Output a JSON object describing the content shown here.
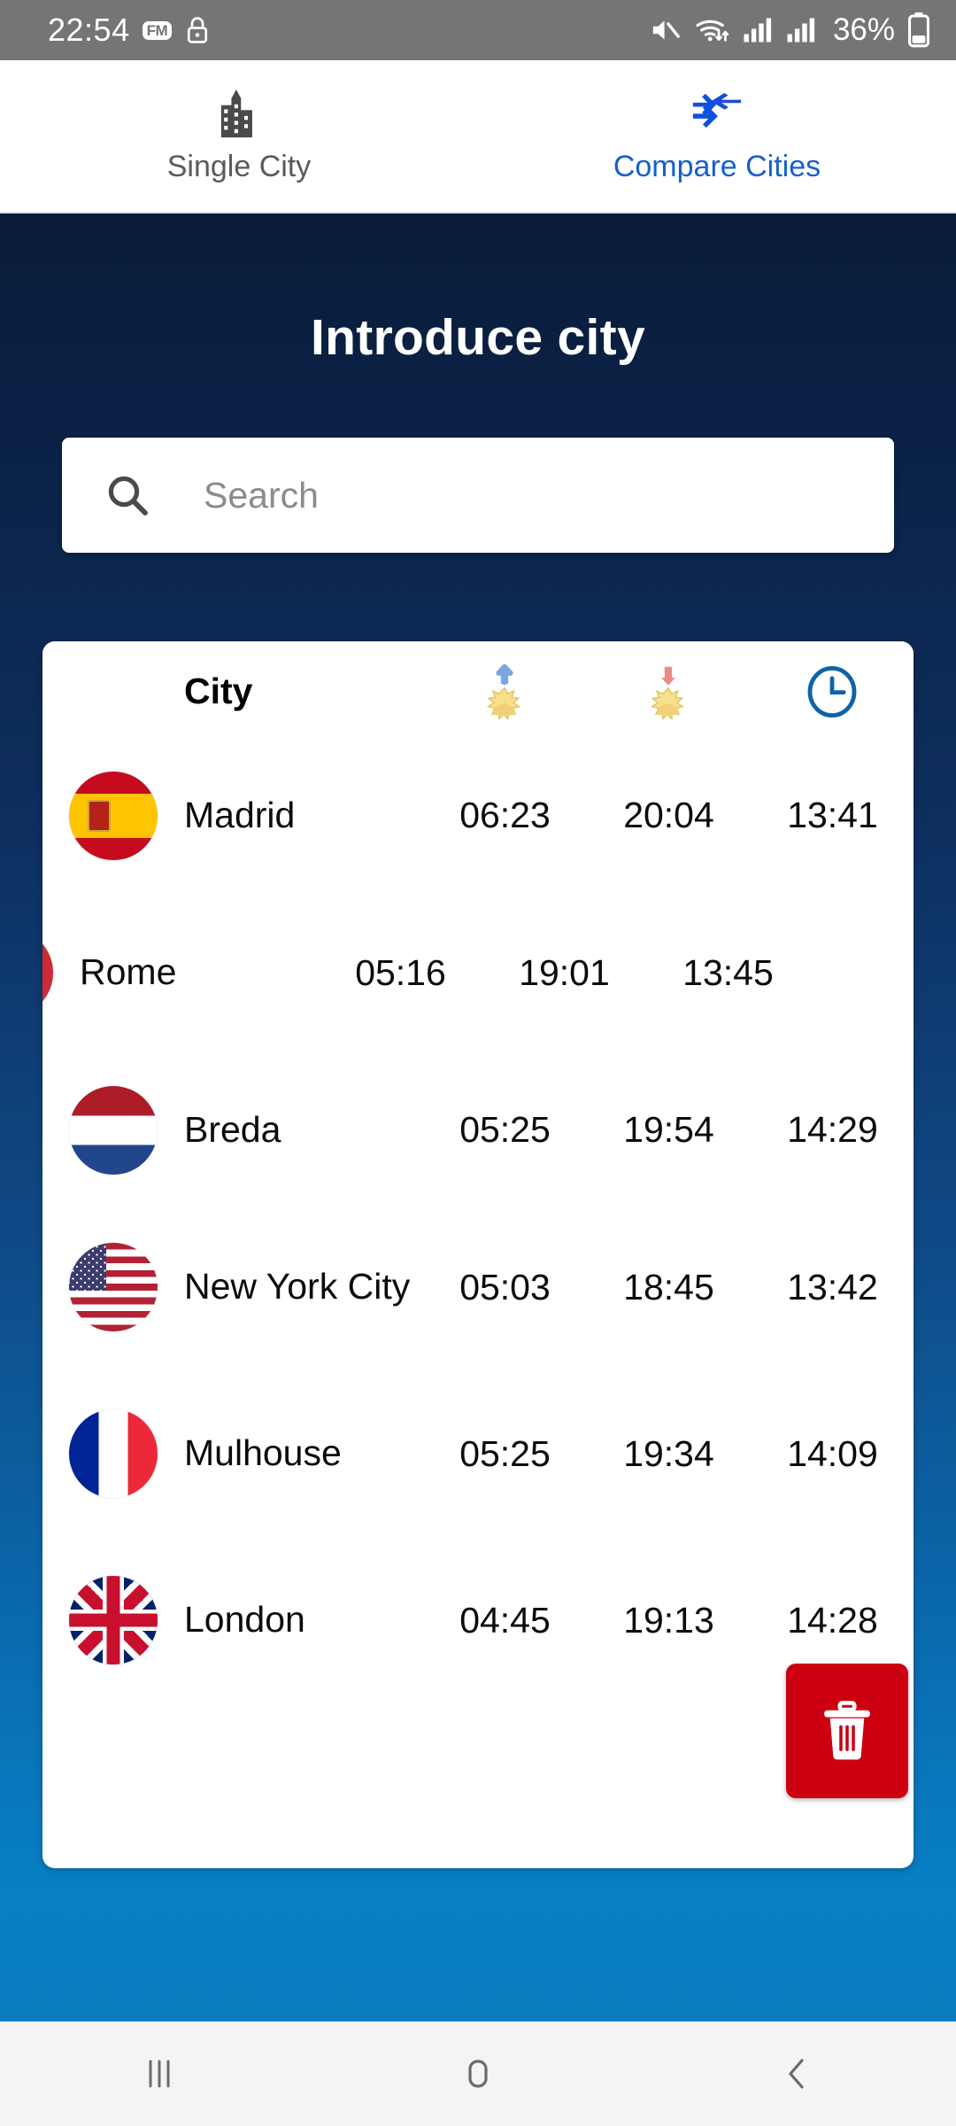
{
  "status_bar": {
    "time": "22:54",
    "fm_badge": "FM",
    "icons_left": [
      "fm-icon",
      "lock-icon"
    ],
    "icons_right": [
      "mute-icon",
      "wifi-icon",
      "signal-icon",
      "signal-icon-2"
    ],
    "battery_text": "36%",
    "battery_icon": "battery-icon"
  },
  "tabs": [
    {
      "label": "Single City",
      "icon": "city-buildings-icon",
      "active": false
    },
    {
      "label": "Compare Cities",
      "icon": "compare-arrows-icon",
      "active": true
    }
  ],
  "header": {
    "title": "Introduce city"
  },
  "search": {
    "placeholder": "Search",
    "value": "",
    "icon": "search-icon"
  },
  "table": {
    "columns": [
      {
        "key": "city",
        "label": "City",
        "icon": null
      },
      {
        "key": "sunrise",
        "label": "",
        "icon": "sunrise-icon"
      },
      {
        "key": "sunset",
        "label": "",
        "icon": "sunset-icon"
      },
      {
        "key": "daylength",
        "label": "",
        "icon": "clock-icon"
      }
    ],
    "rows": [
      {
        "city": "Madrid",
        "flag": "flag-spain",
        "sunrise": "06:23",
        "sunset": "20:04",
        "daylength": "13:41",
        "swiped": false
      },
      {
        "city": "Rome",
        "flag": "flag-italy",
        "sunrise": "05:16",
        "sunset": "19:01",
        "daylength": "13:45",
        "swiped": true
      },
      {
        "city": "Breda",
        "flag": "flag-netherlands",
        "sunrise": "05:25",
        "sunset": "19:54",
        "daylength": "14:29",
        "swiped": false
      },
      {
        "city": "New York City",
        "flag": "flag-usa",
        "sunrise": "05:03",
        "sunset": "18:45",
        "daylength": "13:42",
        "swiped": false
      },
      {
        "city": "Mulhouse",
        "flag": "flag-france",
        "sunrise": "05:25",
        "sunset": "19:34",
        "daylength": "14:09",
        "swiped": false
      },
      {
        "city": "London",
        "flag": "flag-uk",
        "sunrise": "04:45",
        "sunset": "19:13",
        "daylength": "14:28",
        "swiped": false
      }
    ],
    "delete_button": {
      "icon": "trash-icon",
      "label": "",
      "color": "#cc0011"
    }
  },
  "nav_bar": {
    "buttons": [
      {
        "name": "recents",
        "icon": "recents-icon"
      },
      {
        "name": "home",
        "icon": "home-icon"
      },
      {
        "name": "back",
        "icon": "back-icon"
      }
    ]
  },
  "colors": {
    "accent_blue": "#1560cf",
    "gradient_top": "#0a1c3a",
    "gradient_bottom": "#0880c5",
    "delete_red": "#cc0011",
    "status_bar_gray": "#757575"
  }
}
